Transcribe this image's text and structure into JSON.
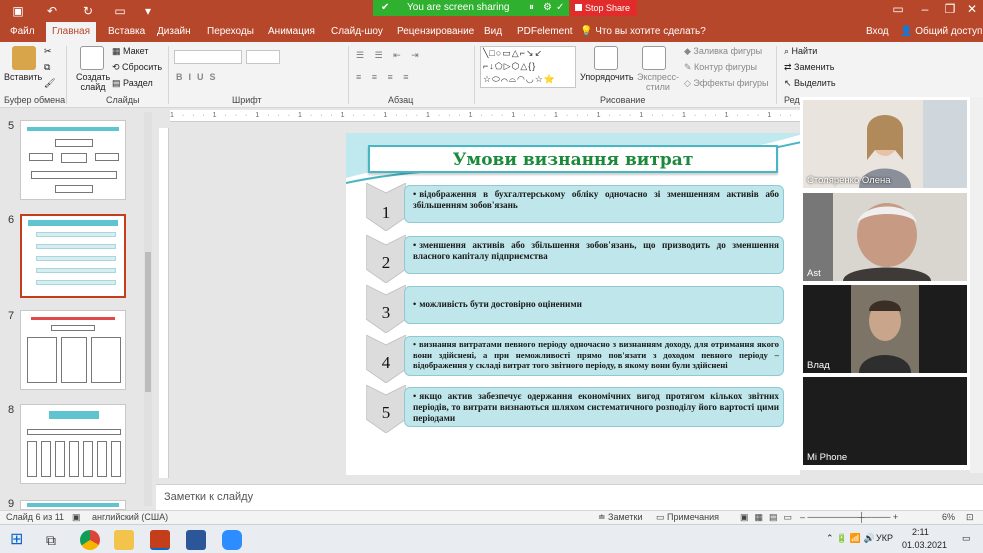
{
  "share": {
    "sharing_text": "You are screen sharing",
    "stop_label": "Stop Share"
  },
  "tabs": [
    "Файл",
    "Главная",
    "Вставка",
    "Дизайн",
    "Переходы",
    "Анимация",
    "Слайд-шоу",
    "Рецензирование",
    "Вид",
    "PDFelement"
  ],
  "tell_me": "Что вы хотите сделать?",
  "account": {
    "login": "Вход",
    "share": "Общий доступ"
  },
  "ribbon": {
    "paste": "Вставить",
    "clipboard_group": "Буфер обмена",
    "new_slide": "Создать слайд",
    "layout": "Макет",
    "reset": "Сбросить",
    "section": "Раздел",
    "slides_group": "Слайды",
    "font_group": "Шрифт",
    "paragraph_group": "Абзац",
    "arrange": "Упорядочить",
    "quick_styles": "Экспресс-стили",
    "shape_fill": "Заливка фигуры",
    "shape_outline": "Контур фигуры",
    "shape_effects": "Эффекты фигуры",
    "drawing_group": "Рисование",
    "find": "Найти",
    "replace": "Заменить",
    "select": "Выделить",
    "editing_group": "Реда"
  },
  "thumbnails": [
    {
      "num": "5",
      "selected": false
    },
    {
      "num": "6",
      "selected": true
    },
    {
      "num": "7",
      "selected": false
    },
    {
      "num": "8",
      "selected": false
    },
    {
      "num": "9",
      "selected": false
    }
  ],
  "slide": {
    "title": "Умови визнання витрат",
    "items": [
      {
        "num": "1",
        "text": "відображення в бухгалтерському обліку одночасно зі зменшенням активів або збільшенням зобов'язань"
      },
      {
        "num": "2",
        "text": "зменшення активів або збільшення зобов'язань, що призводить до зменшення власного капіталу підприємства"
      },
      {
        "num": "3",
        "text": "можливість бути достовірно оціненими"
      },
      {
        "num": "4",
        "text": "визнання витратами певного періоду одночасно з визнанням доходу, для отримання якого вони здійснені, а при неможливості прямо пов'язати з доходом певного періоду – відображення у складі витрат того звітного періоду, в якому вони були здійснені"
      },
      {
        "num": "5",
        "text": "якщо актив забезпечує одержання економічних вигод протягом кількох звітних періодів, то витрати визнаються шляхом систематичного розподілу його вартості цими періодами"
      }
    ]
  },
  "participants": [
    "Столяренко Олена",
    "Ast",
    "Влад",
    "Mi Phone"
  ],
  "notes_placeholder": "Заметки к слайду",
  "status": {
    "slide_info": "Слайд 6 из 11",
    "language": "английский (США)",
    "notes": "Заметки",
    "comments": "Примечания",
    "zoom": "6%"
  },
  "taskbar": {
    "lang": "УКР",
    "time": "2:11",
    "date": "01.03.2021"
  }
}
